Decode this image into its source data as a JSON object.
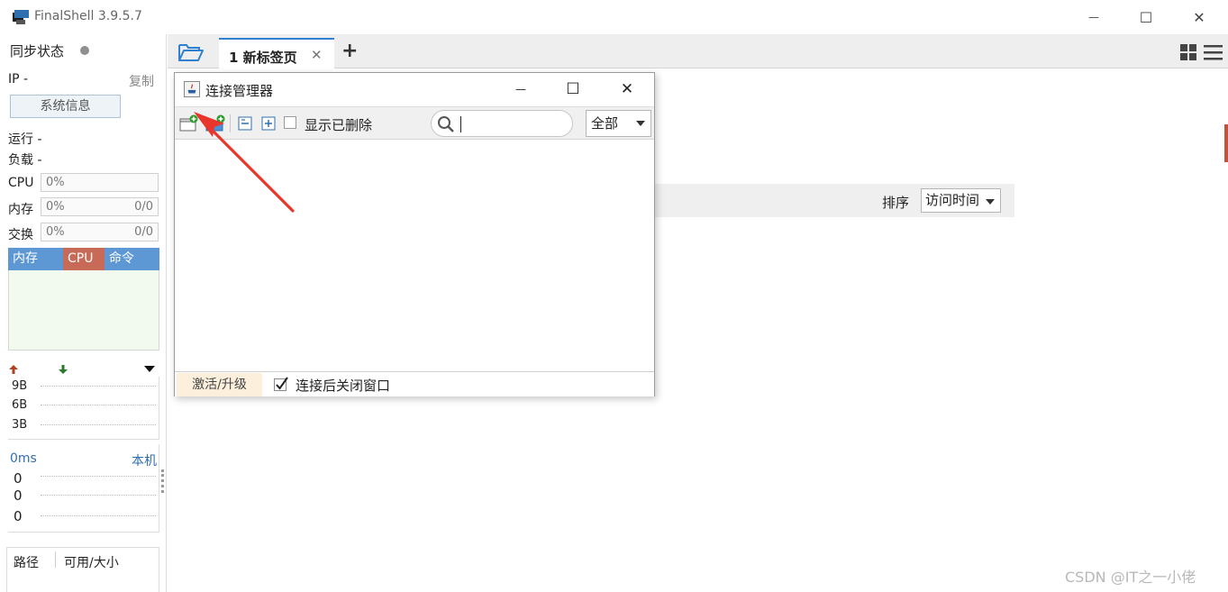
{
  "app": {
    "title": "FinalShell 3.9.5.7",
    "accent_color": "#2f80d1"
  },
  "window_controls": {
    "minimize": "—",
    "maximize": "☐",
    "close": "✕"
  },
  "sidebar": {
    "sync_label": "同步状态",
    "ip_label": "IP  -",
    "copy_label": "复制",
    "sysinfo_button": "系统信息",
    "uptime_label": "运行 -",
    "load_label": "负载 -",
    "cpu": {
      "label": "CPU",
      "value": "0%"
    },
    "mem": {
      "label": "内存",
      "value": "0%",
      "detail": "0/0"
    },
    "swap": {
      "label": "交换",
      "value": "0%",
      "detail": "0/0"
    },
    "process_tabs": [
      {
        "label": "内存",
        "color": "#5d98d4"
      },
      {
        "label": "CPU",
        "color": "#c76a57"
      },
      {
        "label": "命令",
        "color": "#5d98d4"
      }
    ],
    "net_scale": [
      "9B",
      "6B",
      "3B"
    ],
    "latency_label": "0ms",
    "latency_host": "本机",
    "latency_values": [
      "0",
      "0",
      "0"
    ],
    "disk_path_label": "路径",
    "disk_avail_label": "可用/大小"
  },
  "tabs": [
    {
      "label": "1 新标签页",
      "close": "✕"
    }
  ],
  "tab_add": "+",
  "content": {
    "sort_label": "排序",
    "sort_value": "访问时间"
  },
  "dialog": {
    "title": "连接管理器",
    "controls": {
      "minimize": "—",
      "maximize": "☐",
      "close": "✕"
    },
    "show_deleted_label": "显示已删除",
    "show_deleted_checked": false,
    "search_value": "",
    "filter_value": "全部",
    "activate_label": "激活/升级",
    "close_after_label": "连接后关闭窗口",
    "close_after_checked": true
  },
  "watermark": "CSDN @IT之一小佬"
}
